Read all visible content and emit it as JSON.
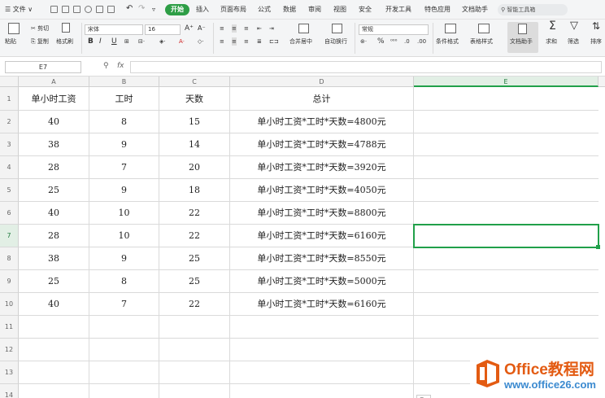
{
  "menubar": {
    "file_label": "文件",
    "tabs": [
      "开始",
      "插入",
      "页面布局",
      "公式",
      "数据",
      "审阅",
      "视图",
      "安全",
      "开发工具",
      "特色应用",
      "文档助手"
    ],
    "search_placeholder": "智能工具箱"
  },
  "ribbon": {
    "paste": "粘贴",
    "cut": "剪切",
    "copy": "复制",
    "format_painter": "格式刷",
    "font_name": "宋体",
    "font_size": "16",
    "bold": "B",
    "italic": "I",
    "underline": "U",
    "merge_center": "合并居中",
    "wrap_text": "自动换行",
    "number_format": "常规",
    "percent": "%",
    "conditional_format": "条件格式",
    "table_style": "表格样式",
    "doc_assistant": "文档助手",
    "sum": "求和",
    "filter": "筛选",
    "sort": "排序"
  },
  "formula_bar": {
    "name_box": "E7",
    "fx_label": "fx",
    "value": ""
  },
  "sheet": {
    "columns": [
      "A",
      "B",
      "C",
      "D",
      "E"
    ],
    "row_numbers": [
      "1",
      "2",
      "3",
      "4",
      "5",
      "6",
      "7",
      "8",
      "9",
      "10",
      "11",
      "12",
      "13",
      "14"
    ],
    "rows": [
      [
        "单小时工资",
        "工时",
        "天数",
        "总计",
        ""
      ],
      [
        "40",
        "8",
        "15",
        "单小时工资*工时*天数=4800元",
        ""
      ],
      [
        "38",
        "9",
        "14",
        "单小时工资*工时*天数=4788元",
        ""
      ],
      [
        "28",
        "7",
        "20",
        "单小时工资*工时*天数=3920元",
        ""
      ],
      [
        "25",
        "9",
        "18",
        "单小时工资*工时*天数=4050元",
        ""
      ],
      [
        "40",
        "10",
        "22",
        "单小时工资*工时*天数=8800元",
        ""
      ],
      [
        "28",
        "10",
        "22",
        "单小时工资*工时*天数=6160元",
        ""
      ],
      [
        "38",
        "9",
        "25",
        "单小时工资*工时*天数=8550元",
        ""
      ],
      [
        "25",
        "8",
        "25",
        "单小时工资*工时*天数=5000元",
        ""
      ],
      [
        "40",
        "7",
        "22",
        "单小时工资*工时*天数=6160元",
        ""
      ],
      [
        "",
        "",
        "",
        "",
        ""
      ],
      [
        "",
        "",
        "",
        "",
        ""
      ],
      [
        "",
        "",
        "",
        "",
        ""
      ],
      [
        "",
        "",
        "",
        "",
        ""
      ]
    ],
    "selected_cell": "E7",
    "paste_options_label": "⎘"
  },
  "watermark": {
    "line1": "Office教程网",
    "line2": "www.office26.com"
  },
  "colors": {
    "accent": "#2e9e46",
    "selection": "#21a04a",
    "watermark_orange": "#e35b12",
    "watermark_blue": "#3b8ad0"
  }
}
